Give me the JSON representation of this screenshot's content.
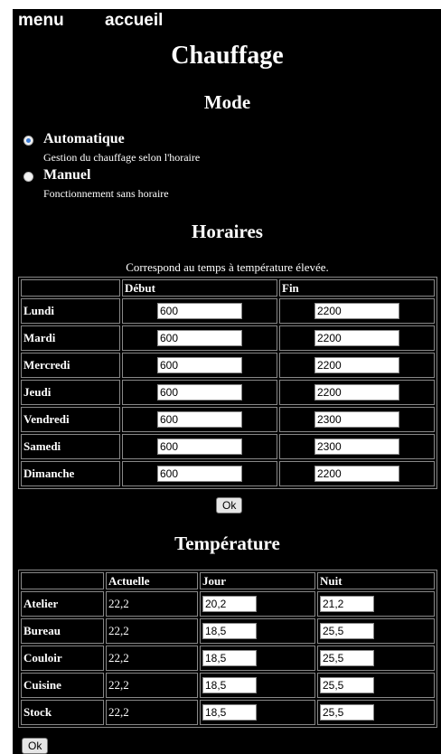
{
  "nav": {
    "menu": "menu",
    "home": "accueil"
  },
  "page": {
    "title": "Chauffage"
  },
  "mode": {
    "heading": "Mode",
    "options": [
      {
        "label": "Automatique",
        "description": "Gestion du chauffage selon l'horaire",
        "selected": true
      },
      {
        "label": "Manuel",
        "description": "Fonctionnement sans horaire",
        "selected": false
      }
    ]
  },
  "schedule": {
    "heading": "Horaires",
    "note": "Correspond au temps à température élevée.",
    "columns": [
      "",
      "Début",
      "Fin"
    ],
    "rows": [
      {
        "day": "Lundi",
        "start": "600",
        "end": "2200"
      },
      {
        "day": "Mardi",
        "start": "600",
        "end": "2200"
      },
      {
        "day": "Mercredi",
        "start": "600",
        "end": "2200"
      },
      {
        "day": "Jeudi",
        "start": "600",
        "end": "2200"
      },
      {
        "day": "Vendredi",
        "start": "600",
        "end": "2300"
      },
      {
        "day": "Samedi",
        "start": "600",
        "end": "2300"
      },
      {
        "day": "Dimanche",
        "start": "600",
        "end": "2200"
      }
    ],
    "ok_label": "Ok"
  },
  "temperature": {
    "heading": "Température",
    "columns": [
      "",
      "Actuelle",
      "Jour",
      "Nuit"
    ],
    "rows": [
      {
        "room": "Atelier",
        "current": "22,2",
        "day": "20,2",
        "night": "21,2"
      },
      {
        "room": "Bureau",
        "current": "22,2",
        "day": "18,5",
        "night": "25,5"
      },
      {
        "room": "Couloir",
        "current": "22,2",
        "day": "18,5",
        "night": "25,5"
      },
      {
        "room": "Cuisine",
        "current": "22,2",
        "day": "18,5",
        "night": "25,5"
      },
      {
        "room": "Stock",
        "current": "22,2",
        "day": "18,5",
        "night": "25,5"
      }
    ],
    "ok_label": "Ok"
  },
  "colors": {
    "background": "#000000",
    "text": "#ffffff",
    "radio_selected": "#3a7bd5"
  }
}
